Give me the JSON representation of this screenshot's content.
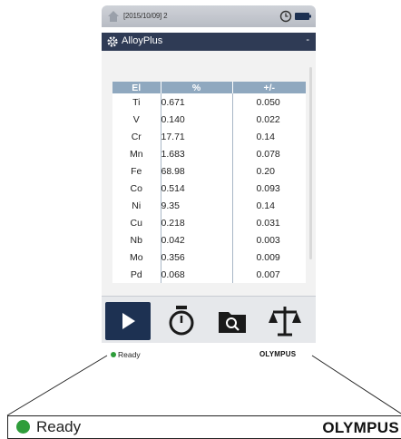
{
  "status_bar": {
    "date": "[2015/10/09] 2"
  },
  "app_bar": {
    "title": "AlloyPlus",
    "menu_glyph": "-"
  },
  "table": {
    "headers": [
      "El",
      "%",
      "+/-"
    ],
    "rows": [
      {
        "el": "Ti",
        "pct": "0.671",
        "err": "0.050"
      },
      {
        "el": "V",
        "pct": "0.140",
        "err": "0.022"
      },
      {
        "el": "Cr",
        "pct": "17.71",
        "err": "0.14"
      },
      {
        "el": "Mn",
        "pct": "1.683",
        "err": "0.078"
      },
      {
        "el": "Fe",
        "pct": "68.98",
        "err": "0.20"
      },
      {
        "el": "Co",
        "pct": "0.514",
        "err": "0.093"
      },
      {
        "el": "Ni",
        "pct": "9.35",
        "err": "0.14"
      },
      {
        "el": "Cu",
        "pct": "0.218",
        "err": "0.031"
      },
      {
        "el": "Nb",
        "pct": "0.042",
        "err": "0.003"
      },
      {
        "el": "Mo",
        "pct": "0.356",
        "err": "0.009"
      },
      {
        "el": "Pd",
        "pct": "0.068",
        "err": "0.007"
      }
    ]
  },
  "toolbar": {
    "icons": [
      "play-icon",
      "stopwatch-icon",
      "folder-search-icon",
      "balance-scale-icon"
    ]
  },
  "status": {
    "text": "Ready",
    "color": "#2e9d3a"
  },
  "brand": "OLYMPUS",
  "zoom": {
    "status_text": "Ready",
    "brand": "OLYMPUS"
  },
  "colors": {
    "header_bar": "#2f3b55",
    "table_header": "#8fa8bf",
    "play_button": "#1d3152",
    "ready_dot": "#2e9d3a"
  }
}
